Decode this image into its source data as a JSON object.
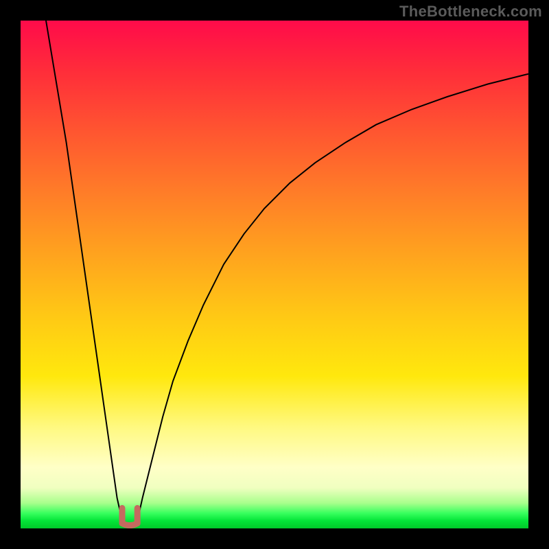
{
  "watermark": "TheBottleneck.com",
  "colors": {
    "frame": "#000000",
    "curve_stroke": "#000000",
    "curve_stroke_width": 2,
    "marker_fill": "#c46a5f",
    "marker_stroke": "#c46a5f",
    "gradient_stops": [
      "#ff0b4a",
      "#ff2d3a",
      "#ff5630",
      "#ff7d28",
      "#ffa31e",
      "#ffc815",
      "#ffe80d",
      "#fff980",
      "#ffffc7",
      "#f0ffc0",
      "#a8ff8c",
      "#38ff5e",
      "#04e538",
      "#00c92a"
    ]
  },
  "chart_data": {
    "type": "line",
    "title": "",
    "xlabel": "",
    "ylabel": "",
    "xlim": [
      0,
      100
    ],
    "ylim": [
      0,
      100
    ],
    "grid": false,
    "legend": false,
    "curve_left": {
      "description": "steep descending branch from top-left down to the minimum; x mapped 0–100 (% of inner width), y mapped 0–100 (0=bottom,100=top)",
      "x": [
        5,
        6,
        7,
        8,
        9,
        10,
        11,
        12,
        13,
        14,
        15,
        16,
        17,
        18,
        19,
        20
      ],
      "y": [
        100,
        94,
        88,
        82,
        76,
        69,
        62,
        55,
        48,
        41,
        34,
        27,
        20,
        13,
        6,
        1.5
      ]
    },
    "curve_right": {
      "description": "ascending branch rising from the minimum with decreasing slope toward the right edge",
      "x": [
        23,
        24,
        26,
        28,
        30,
        33,
        36,
        40,
        44,
        48,
        53,
        58,
        64,
        70,
        77,
        84,
        92,
        100
      ],
      "y": [
        1.5,
        6,
        14,
        22,
        29,
        37,
        44,
        52,
        58,
        63,
        68,
        72,
        76,
        79.5,
        82.5,
        85,
        87.5,
        89.5
      ]
    },
    "minimum_marker": {
      "description": "small U-shaped salmon marker at the valley bottom",
      "x": 21.5,
      "y": 1,
      "width": 3,
      "height": 3
    }
  }
}
